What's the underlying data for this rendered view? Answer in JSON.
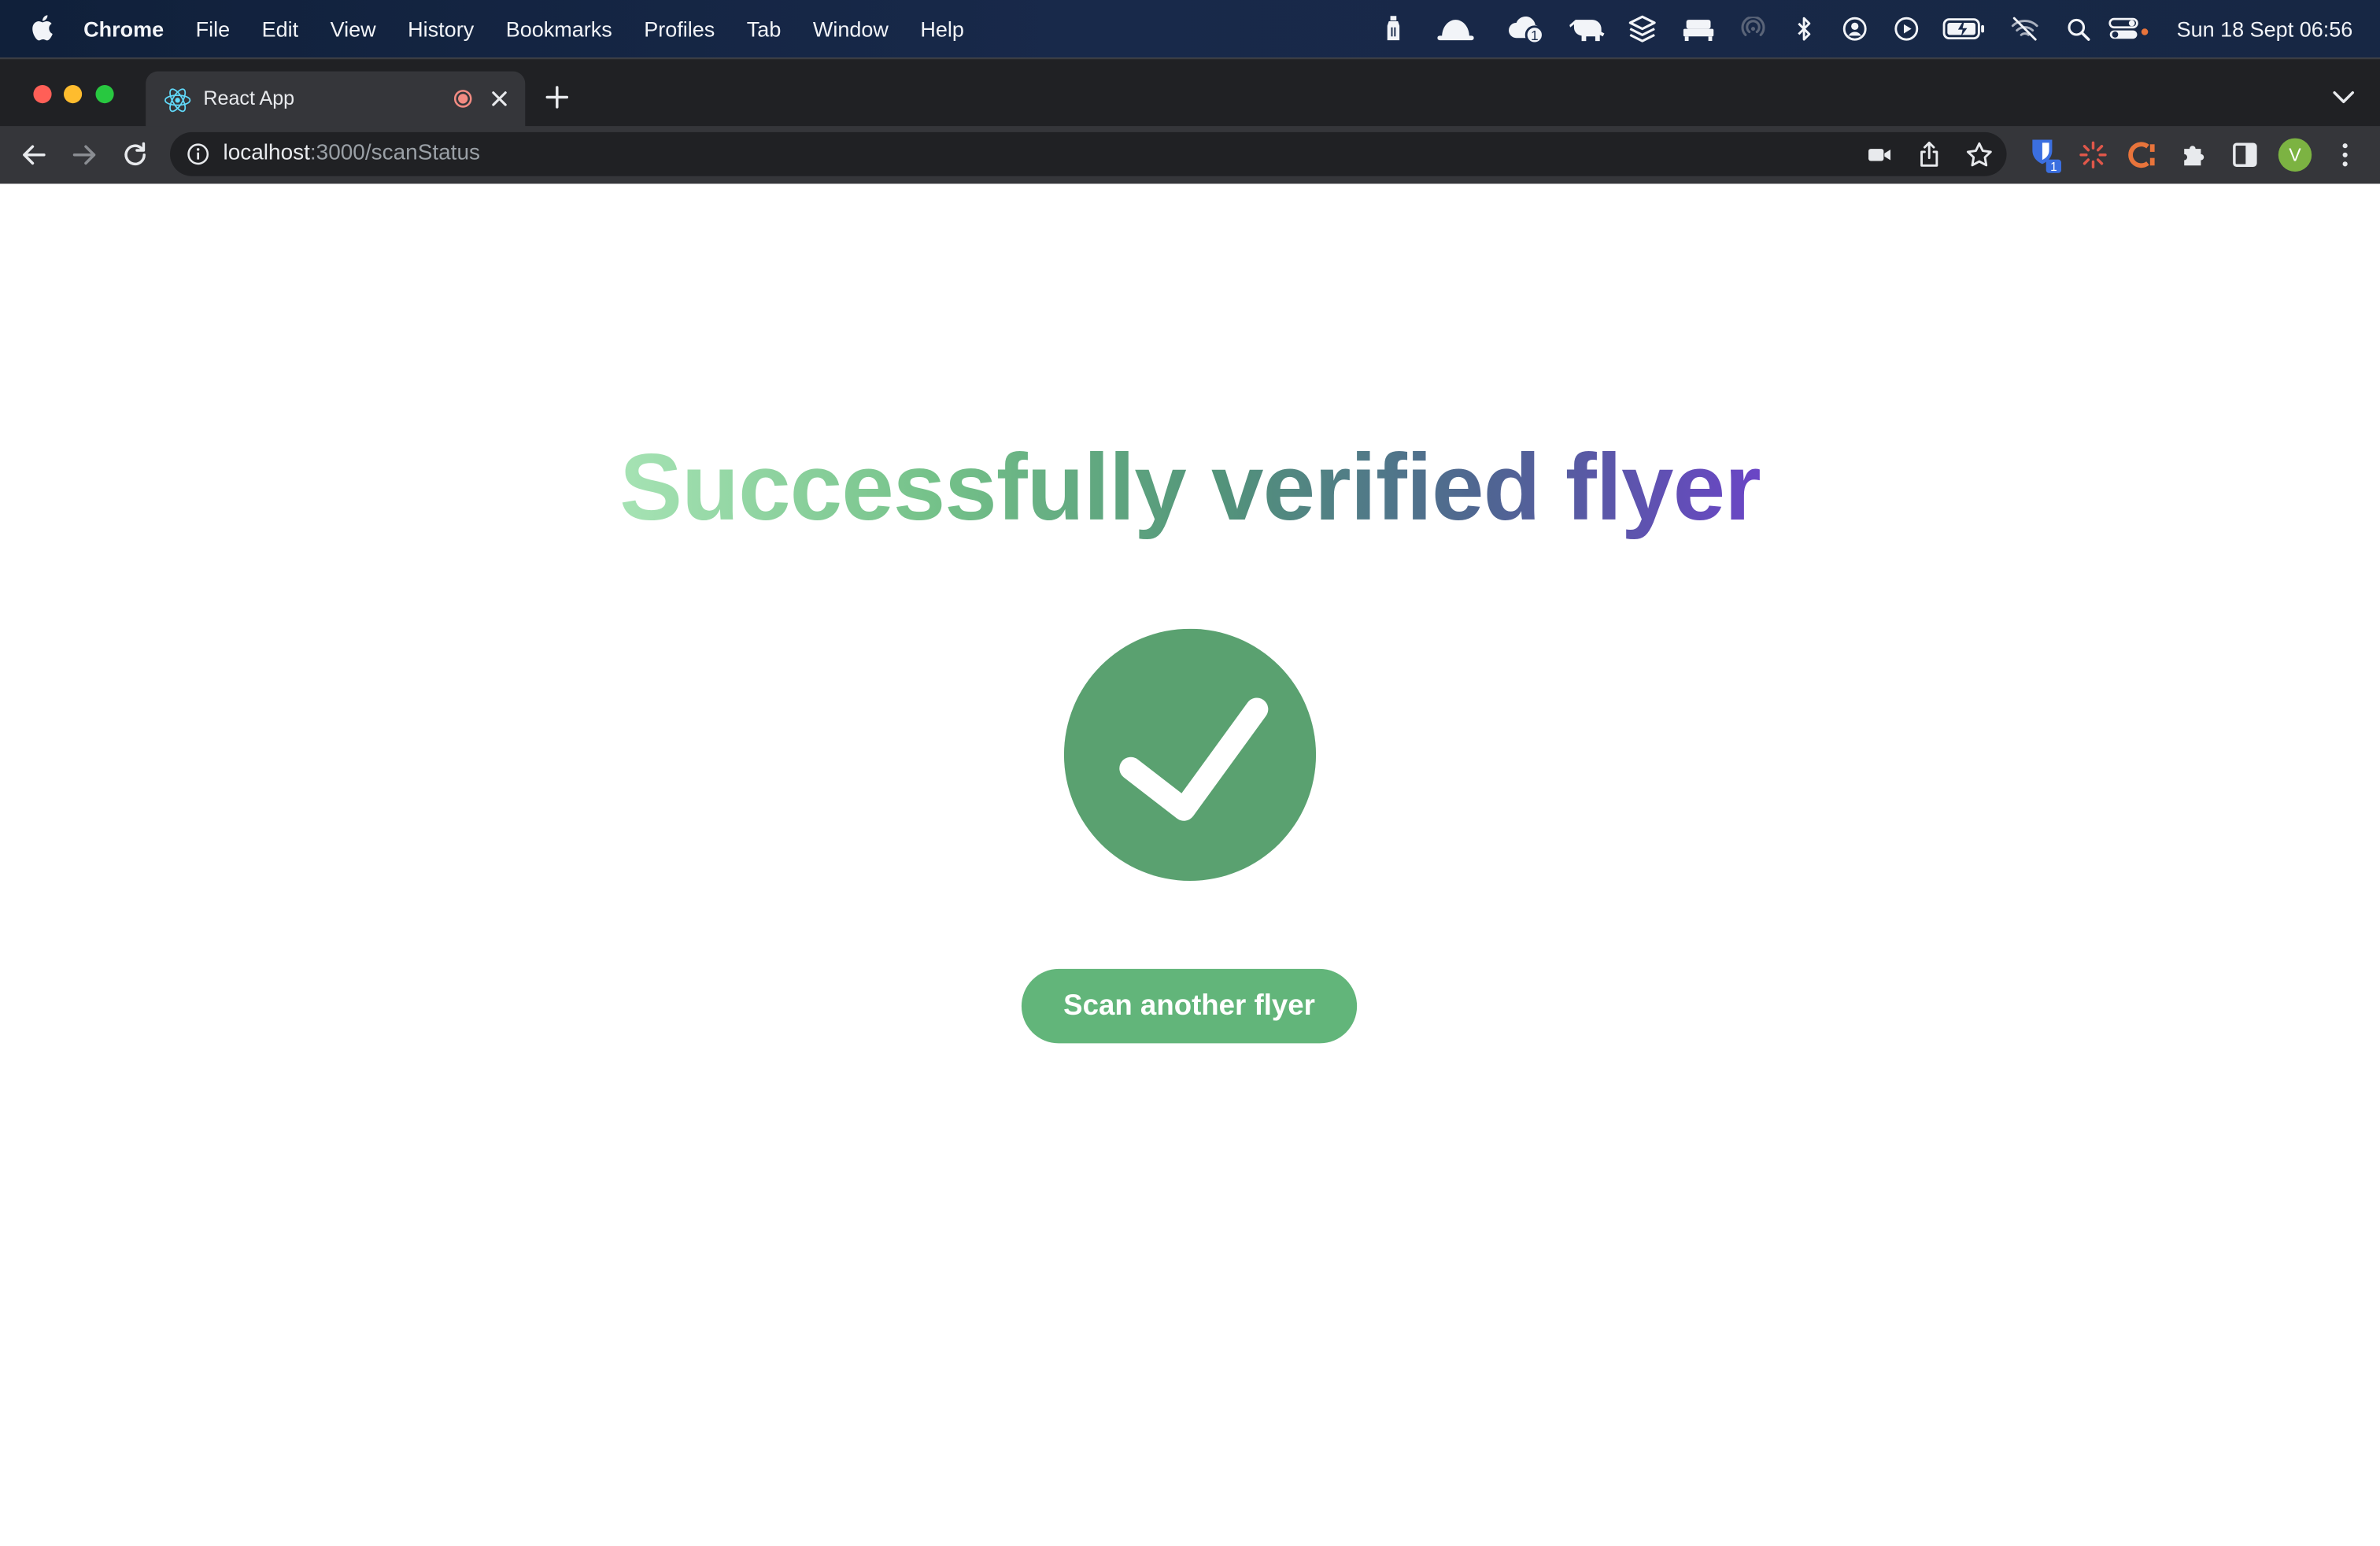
{
  "menubar": {
    "app_name": "Chrome",
    "items": [
      "File",
      "Edit",
      "View",
      "History",
      "Bookmarks",
      "Profiles",
      "Tab",
      "Window",
      "Help"
    ],
    "clock": "Sun 18 Sept  06:56",
    "status_icons": [
      "bottle-icon",
      "helmet-icon",
      "cloud-badge-icon",
      "elephant-icon",
      "layers-icon",
      "bed-icon",
      "airdrop-icon",
      "bluetooth-icon",
      "user-icon",
      "play-icon",
      "battery-icon",
      "wifi-off-icon",
      "search-icon",
      "control-center-icon"
    ],
    "cloud_badge": "1"
  },
  "browser": {
    "tab_title": "React App",
    "url_host": "localhost",
    "url_path": ":3000/scanStatus",
    "extension_badge": "1",
    "avatar_letter": "V"
  },
  "page": {
    "headline": "Successfully verified flyer",
    "button_label": "Scan another flyer"
  },
  "colors": {
    "success_green": "#5aa170",
    "button_green": "#62b57a",
    "gradient_start": "#a6e3b4",
    "gradient_end": "#6a45c6"
  }
}
